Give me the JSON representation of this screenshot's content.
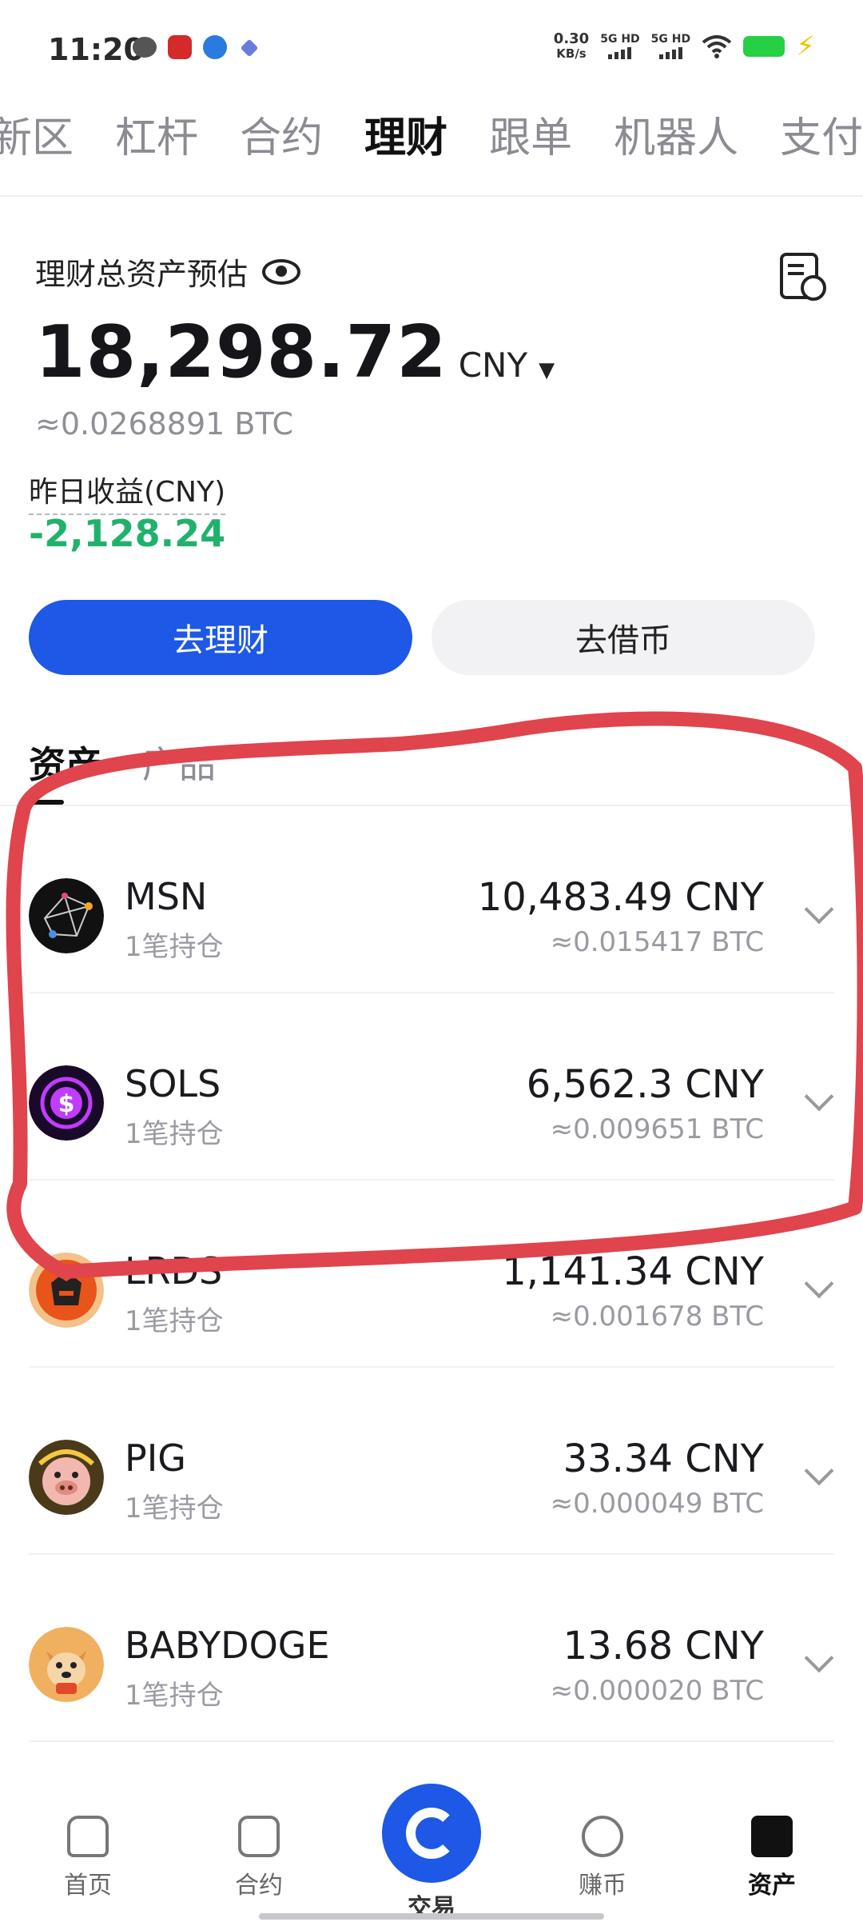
{
  "status_bar": {
    "time": "11:20",
    "speed_value": "0.30",
    "speed_unit": "KB/s",
    "sim1": "5G HD",
    "sim2": "5G HD"
  },
  "top_tabs": [
    "新区",
    "杠杆",
    "合约",
    "理财",
    "跟单",
    "机器人",
    "支付"
  ],
  "top_tabs_active": "理财",
  "summary": {
    "title": "理财总资产预估",
    "total": "18,298.72",
    "currency": "CNY",
    "btc_equiv": "≈0.0268891  BTC",
    "yesterday_label": "昨日收益(CNY)",
    "yesterday_value": "-2,128.24"
  },
  "buttons": {
    "earn": "去理财",
    "borrow": "去借币"
  },
  "sub_tabs": [
    "资产",
    "产品"
  ],
  "assets": [
    {
      "name": "MSN",
      "positions": "1笔持仓",
      "value": "10,483.49 CNY",
      "btc": "≈0.015417 BTC"
    },
    {
      "name": "SOLS",
      "positions": "1笔持仓",
      "value": "6,562.3 CNY",
      "btc": "≈0.009651 BTC"
    },
    {
      "name": "LRDS",
      "positions": "1笔持仓",
      "value": "1,141.34 CNY",
      "btc": "≈0.001678 BTC"
    },
    {
      "name": "PIG",
      "positions": "1笔持仓",
      "value": "33.34 CNY",
      "btc": "≈0.000049 BTC"
    },
    {
      "name": "BABYDOGE",
      "positions": "1笔持仓",
      "value": "13.68 CNY",
      "btc": "≈0.000020 BTC"
    }
  ],
  "bottom_nav": [
    "首页",
    "合约",
    "交易",
    "赚币",
    "资产"
  ],
  "colors": {
    "primary": "#1d58e6",
    "negative_green": "#20b26c",
    "annotation_red": "#e0444c"
  }
}
